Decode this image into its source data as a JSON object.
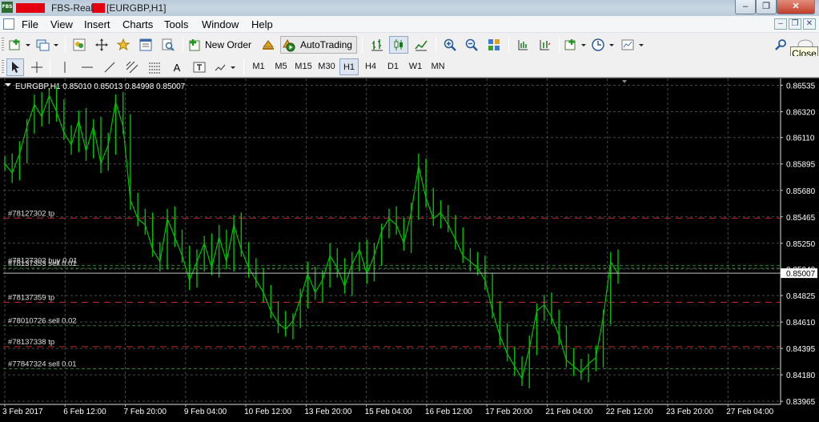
{
  "window": {
    "title_part1": "FBS-Real",
    "title_part2": "[EURGBP,H1]",
    "app_icon_label": "FBS",
    "controls": {
      "minimize": "–",
      "restore": "❐",
      "close": "✕"
    }
  },
  "menu": {
    "items": [
      "File",
      "View",
      "Insert",
      "Charts",
      "Tools",
      "Window",
      "Help"
    ],
    "mdi_controls": [
      "–",
      "❐",
      "✕"
    ]
  },
  "toolbar": {
    "new_order_label": "New Order",
    "autotrading_label": "AutoTrading",
    "tooltip": "Close"
  },
  "timeframes": {
    "items": [
      "M1",
      "M5",
      "M15",
      "M30",
      "H1",
      "H4",
      "D1",
      "W1",
      "MN"
    ],
    "active": "H1"
  },
  "colors": {
    "chart_bg": "#000000",
    "candle": "#00c000",
    "grid": "#4a4a4a",
    "tp_line": "#c62828",
    "order_line": "#2e7d32",
    "bid_line": "#c0c0c0"
  },
  "chart_data": {
    "type": "line",
    "header": "EURGBP,H1  0.85010 0.85013 0.84998 0.85007",
    "symbol": "EURGBP,H1",
    "ohlc": {
      "open": 0.8501,
      "high": 0.85013,
      "low": 0.84998,
      "close": 0.85007
    },
    "current_price": 0.85007,
    "current_price_label": "0.85007",
    "ylim": [
      0.8394,
      0.8659
    ],
    "y_ticks": [
      0.86535,
      0.8632,
      0.8611,
      0.85895,
      0.8568,
      0.85465,
      0.8525,
      0.8504,
      0.84825,
      0.8461,
      0.84395,
      0.8418,
      0.83965
    ],
    "x_ticks": [
      "3 Feb 2017",
      "6 Feb 12:00",
      "7 Feb 20:00",
      "9 Feb 04:00",
      "10 Feb 12:00",
      "13 Feb 20:00",
      "15 Feb 04:00",
      "16 Feb 12:00",
      "17 Feb 20:00",
      "21 Feb 04:00",
      "22 Feb 12:00",
      "23 Feb 20:00",
      "27 Feb 04:00"
    ],
    "series": [
      {
        "values": [
          0.859,
          0.8582,
          0.8598,
          0.862,
          0.8638,
          0.8628,
          0.8645,
          0.8632,
          0.8615,
          0.8605,
          0.8625,
          0.86,
          0.862,
          0.859,
          0.8605,
          0.864,
          0.862,
          0.856,
          0.8545,
          0.854,
          0.852,
          0.851,
          0.8545,
          0.853,
          0.8515,
          0.8495,
          0.851,
          0.8525,
          0.8505,
          0.853,
          0.851,
          0.854,
          0.852,
          0.8505,
          0.8495,
          0.8485,
          0.847,
          0.846,
          0.8455,
          0.8462,
          0.848,
          0.85,
          0.8485,
          0.8495,
          0.8515,
          0.8505,
          0.849,
          0.8508,
          0.852,
          0.85,
          0.8515,
          0.8535,
          0.8545,
          0.854,
          0.8525,
          0.855,
          0.8588,
          0.8562,
          0.8545,
          0.855,
          0.854,
          0.8528,
          0.8515,
          0.851,
          0.8505,
          0.8495,
          0.847,
          0.845,
          0.8435,
          0.8425,
          0.8415,
          0.844,
          0.847,
          0.8475,
          0.8465,
          0.845,
          0.843,
          0.8425,
          0.842,
          0.8427,
          0.8432,
          0.8465,
          0.851,
          0.85
        ]
      }
    ],
    "price_lines": [
      {
        "label": "#78127302 tp",
        "price": 0.85455,
        "kind": "tp"
      },
      {
        "label": "#78127302 buy 0.01",
        "price": 0.85069,
        "kind": "order"
      },
      {
        "label": "#78137353 sell 0.01",
        "price": 0.85047,
        "kind": "order"
      },
      {
        "label": "#78137359 tp",
        "price": 0.8477,
        "kind": "tp"
      },
      {
        "label": "#78010726 sell 0.02",
        "price": 0.8458,
        "kind": "order"
      },
      {
        "label": "#78137338 tp",
        "price": 0.8441,
        "kind": "tp"
      },
      {
        "label": "#77847324 sell 0.01",
        "price": 0.8423,
        "kind": "order"
      }
    ]
  }
}
